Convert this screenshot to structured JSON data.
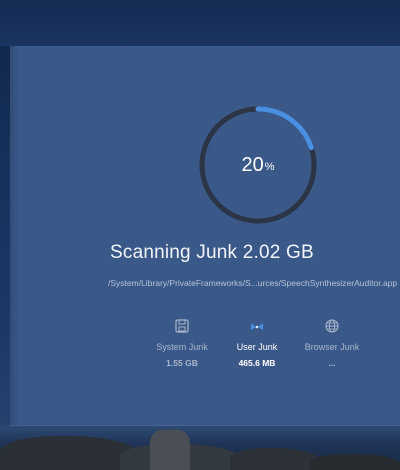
{
  "scan": {
    "percent_value": "20",
    "percent_unit": "%",
    "progress_fraction": 0.2,
    "title": "Scanning Junk 2.02 GB",
    "current_path": "/System/Library/PrivateFrameworks/S...urces/SpeechSynthesizerAuditor.app"
  },
  "categories": [
    {
      "label": "System Junk",
      "value": "1.55 GB",
      "icon": "disk-icon",
      "active": false
    },
    {
      "label": "User Junk",
      "value": "465.6 MB",
      "icon": "user-junk-icon",
      "active": true
    },
    {
      "label": "Browser Junk",
      "value": "...",
      "icon": "globe-icon",
      "active": false
    }
  ],
  "colors": {
    "accent": "#4a90e2",
    "panel": "#3a5888",
    "ring_track": "#2b3545",
    "muted_text": "#a9b6cc"
  }
}
